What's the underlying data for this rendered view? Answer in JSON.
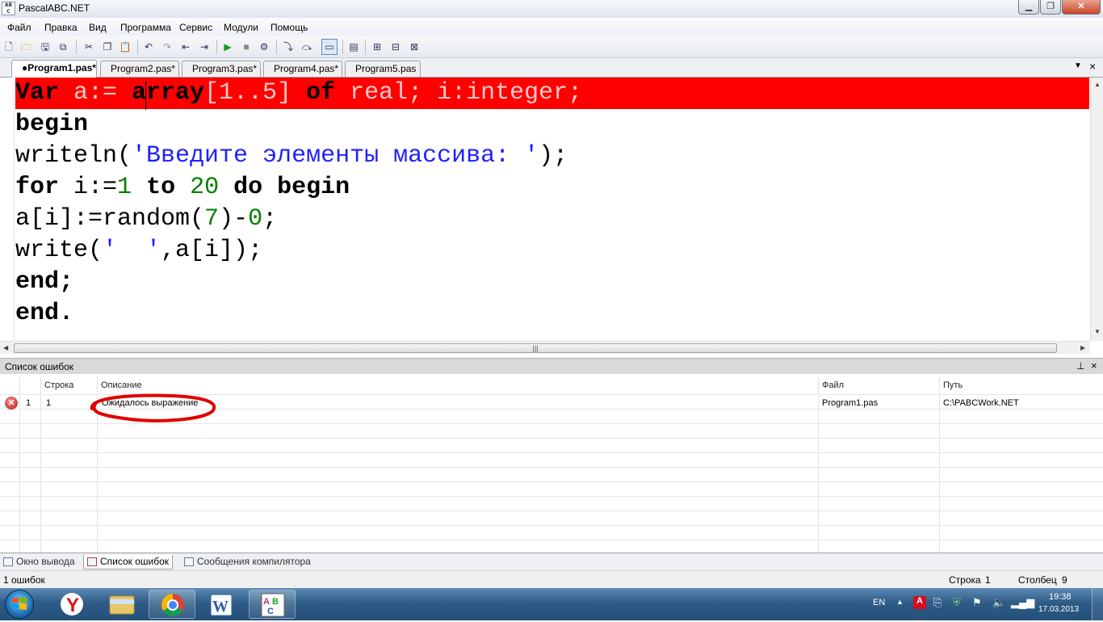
{
  "window": {
    "title": "PascalABC.NET",
    "icon_text": "AB\nC"
  },
  "menu": [
    "Файл",
    "Правка",
    "Вид",
    "Программа",
    "Сервис",
    "Модули",
    "Помощь"
  ],
  "toolbar_icons": [
    "new-file-icon",
    "open-icon",
    "save-icon",
    "save-all-icon",
    "cut-icon",
    "copy-icon",
    "paste-icon",
    "undo-icon",
    "redo-icon",
    "unindent-icon",
    "indent-icon",
    "run-icon",
    "stop-icon",
    "debug-icon",
    "step-into-icon",
    "step-over-icon",
    "output-window-icon",
    "form-designer-icon",
    "compile-icon",
    "build-icon",
    "rebuild-icon"
  ],
  "tabs": [
    {
      "label": "●Program1.pas*",
      "active": true
    },
    {
      "label": "Program2.pas*",
      "active": false
    },
    {
      "label": "Program3.pas*",
      "active": false
    },
    {
      "label": "Program4.pas*",
      "active": false
    },
    {
      "label": "Program5.pas",
      "active": false
    }
  ],
  "code": {
    "l1": {
      "kw1": "Var",
      "t1": " a:= ",
      "kw2": "array",
      "t2": "[1..5] ",
      "kw3": "of",
      "t3": " real; i:integer;"
    },
    "l2": {
      "kw1": "begin"
    },
    "l3": {
      "t1": "writeln(",
      "s1": "'Введите элементы массива: '",
      "t2": ");"
    },
    "l4": {
      "kw1": "for",
      "t1": " i:=",
      "n1": "1",
      "t2": " ",
      "kw2": "to",
      "t3": " ",
      "n2": "20",
      "t4": " ",
      "kw3": "do",
      "t5": " ",
      "kw4": "begin"
    },
    "l5": {
      "t1": "a[i]:=random(",
      "n1": "7",
      "t2": ")-",
      "n2": "0",
      "t3": ";"
    },
    "l6": {
      "t1": "write(",
      "s1": "'  '",
      "t2": ",a[i]);"
    },
    "l7": {
      "kw1": "end",
      "t1": ";"
    },
    "l8": {
      "kw1": "end",
      "t1": "."
    }
  },
  "error_panel": {
    "title": "Список ошибок",
    "columns": {
      "line": "Строка",
      "description": "Описание",
      "file": "Файл",
      "path": "Путь"
    },
    "rows": [
      {
        "num": "1",
        "line": "1",
        "description": "Ожидалось выражение",
        "file": "Program1.pas",
        "path": "C:\\PABCWork.NET"
      }
    ],
    "annotation_color": "#e00000"
  },
  "bottom_tabs": [
    "Окно вывода",
    "Список ошибок",
    "Сообщения компилятора"
  ],
  "status": {
    "errors": "1 ошибок",
    "line_label": "Строка",
    "line_value": "1",
    "col_label": "Столбец",
    "col_value": "9"
  },
  "taskbar": {
    "apps": [
      "yandex-browser-icon",
      "file-explorer-icon",
      "chrome-icon",
      "word-icon",
      "pascalabc-icon"
    ],
    "tray": {
      "lang": "EN",
      "time": "19:38",
      "date": "17.03.2013"
    }
  },
  "colors": {
    "error_line": "#ff0000",
    "keyword": "#000000",
    "string": "#1f1fff",
    "number": "#008000"
  }
}
